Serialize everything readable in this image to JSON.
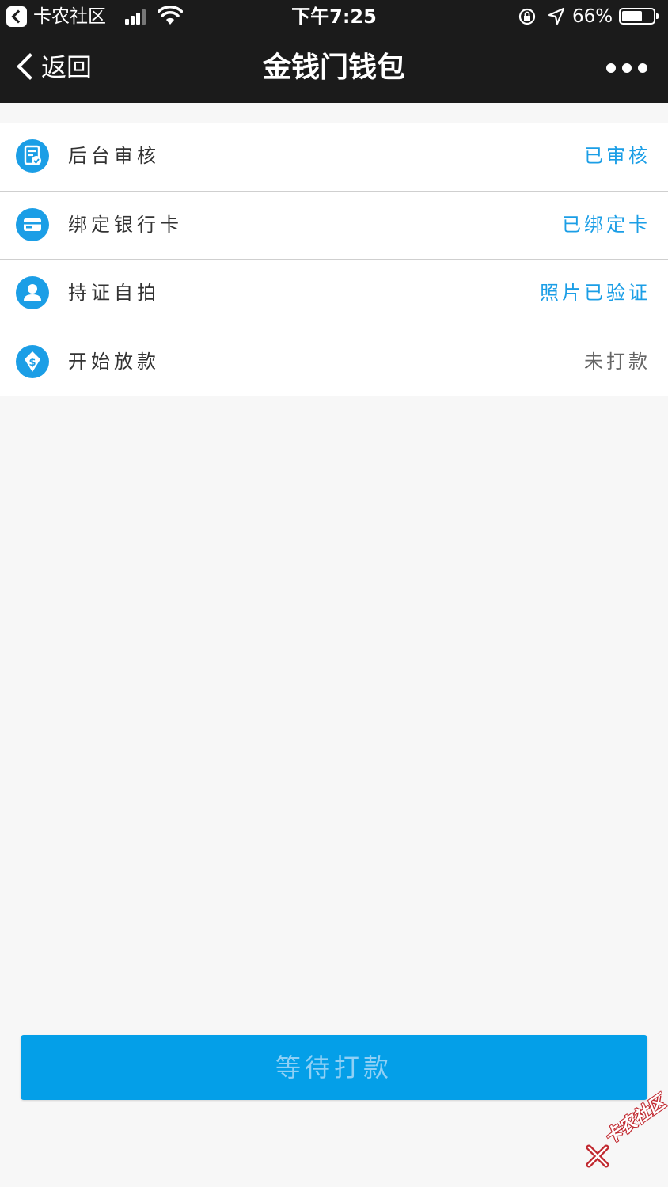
{
  "status_bar": {
    "app_name": "卡农社区",
    "time": "下午7:25",
    "battery_percent": "66%",
    "battery_level": 0.66,
    "signal_bars": 3
  },
  "nav": {
    "back_label": "返回",
    "title": "金钱门钱包"
  },
  "steps": [
    {
      "label": "后台审核",
      "status": "已审核",
      "status_color": "#1b9ee6",
      "icon": "document-check-icon"
    },
    {
      "label": "绑定银行卡",
      "status": "已绑定卡",
      "status_color": "#1b9ee6",
      "icon": "bank-card-icon"
    },
    {
      "label": "持证自拍",
      "status": "照片已验证",
      "status_color": "#1b9ee6",
      "icon": "user-icon"
    },
    {
      "label": "开始放款",
      "status": "未打款",
      "status_color": "#666666",
      "icon": "money-bag-icon"
    }
  ],
  "button": {
    "label": "等待打款"
  },
  "watermark": {
    "text": "卡农社区"
  },
  "colors": {
    "accent": "#1b9ee6",
    "button_bg": "#049fe8",
    "header_bg": "#1b1b1b"
  }
}
